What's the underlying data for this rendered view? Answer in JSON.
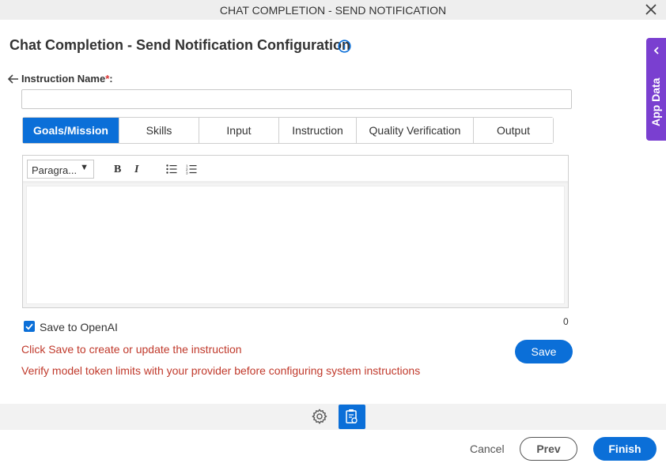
{
  "window": {
    "title": "CHAT COMPLETION - SEND NOTIFICATION",
    "close_icon": "close-icon"
  },
  "page": {
    "heading": "Chat Completion - Send Notification Configuration",
    "info_icon": "info-icon"
  },
  "form": {
    "instruction_label": "Instruction Name",
    "required_marker": "*",
    "label_colon": ":",
    "instruction_value": ""
  },
  "tabs": [
    {
      "label": "Goals/Mission",
      "active": true
    },
    {
      "label": "Skills",
      "active": false
    },
    {
      "label": "Input",
      "active": false
    },
    {
      "label": "Instruction",
      "active": false
    },
    {
      "label": "Quality Verification",
      "active": false
    },
    {
      "label": "Output",
      "active": false
    }
  ],
  "editor": {
    "paragraph_select": "Paragra...",
    "dropdown_arrow": "▼",
    "bold": "B",
    "italic": "I",
    "content": ""
  },
  "char_count": "0",
  "save_openai": {
    "label": "Save to OpenAI",
    "checked": true
  },
  "messages": {
    "info1": "Click Save to create or update the instruction",
    "info2": "Verify model token limits with your provider before configuring system instructions"
  },
  "buttons": {
    "save": "Save",
    "cancel": "Cancel",
    "prev": "Prev",
    "finish": "Finish"
  },
  "side_panel": {
    "label": "App Data"
  },
  "colors": {
    "accent": "#0b6fd8",
    "side_panel": "#7a3fd0",
    "error_text": "#c0392b"
  }
}
